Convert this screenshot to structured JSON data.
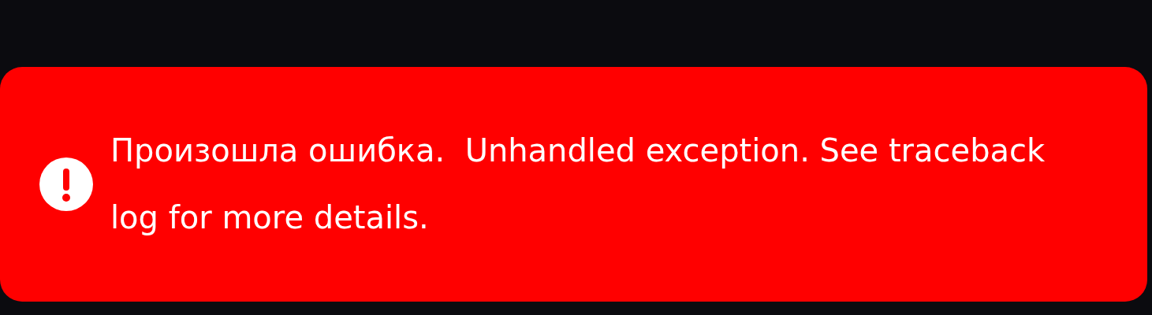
{
  "alert": {
    "kind": "error",
    "message": "Произошла ошибка.  Unhandled exception. See traceback log for more details."
  }
}
